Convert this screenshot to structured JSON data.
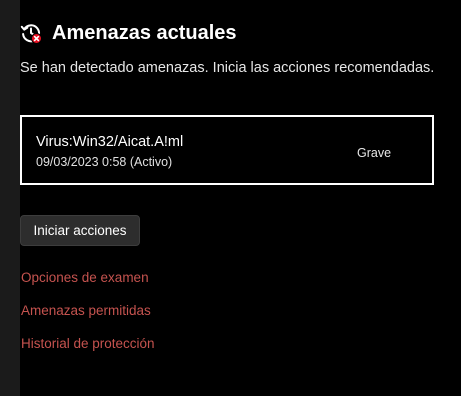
{
  "header": {
    "title": "Amenazas actuales",
    "icon": "clock-threat-icon"
  },
  "subtitle": "Se han detectado amenazas. Inicia las acciones recomendadas.",
  "threat": {
    "name": "Virus:Win32/Aicat.A!ml",
    "date": "09/03/2023 0:58 (Activo)",
    "severity": "Grave"
  },
  "actions": {
    "start_label": "Iniciar acciones"
  },
  "links": [
    {
      "label": "Opciones de examen"
    },
    {
      "label": "Amenazas permitidas"
    },
    {
      "label": "Historial de protección"
    }
  ],
  "colors": {
    "background": "#000000",
    "link": "#c5534f",
    "alert_badge": "#e81123",
    "button": "#2d2d2d"
  }
}
